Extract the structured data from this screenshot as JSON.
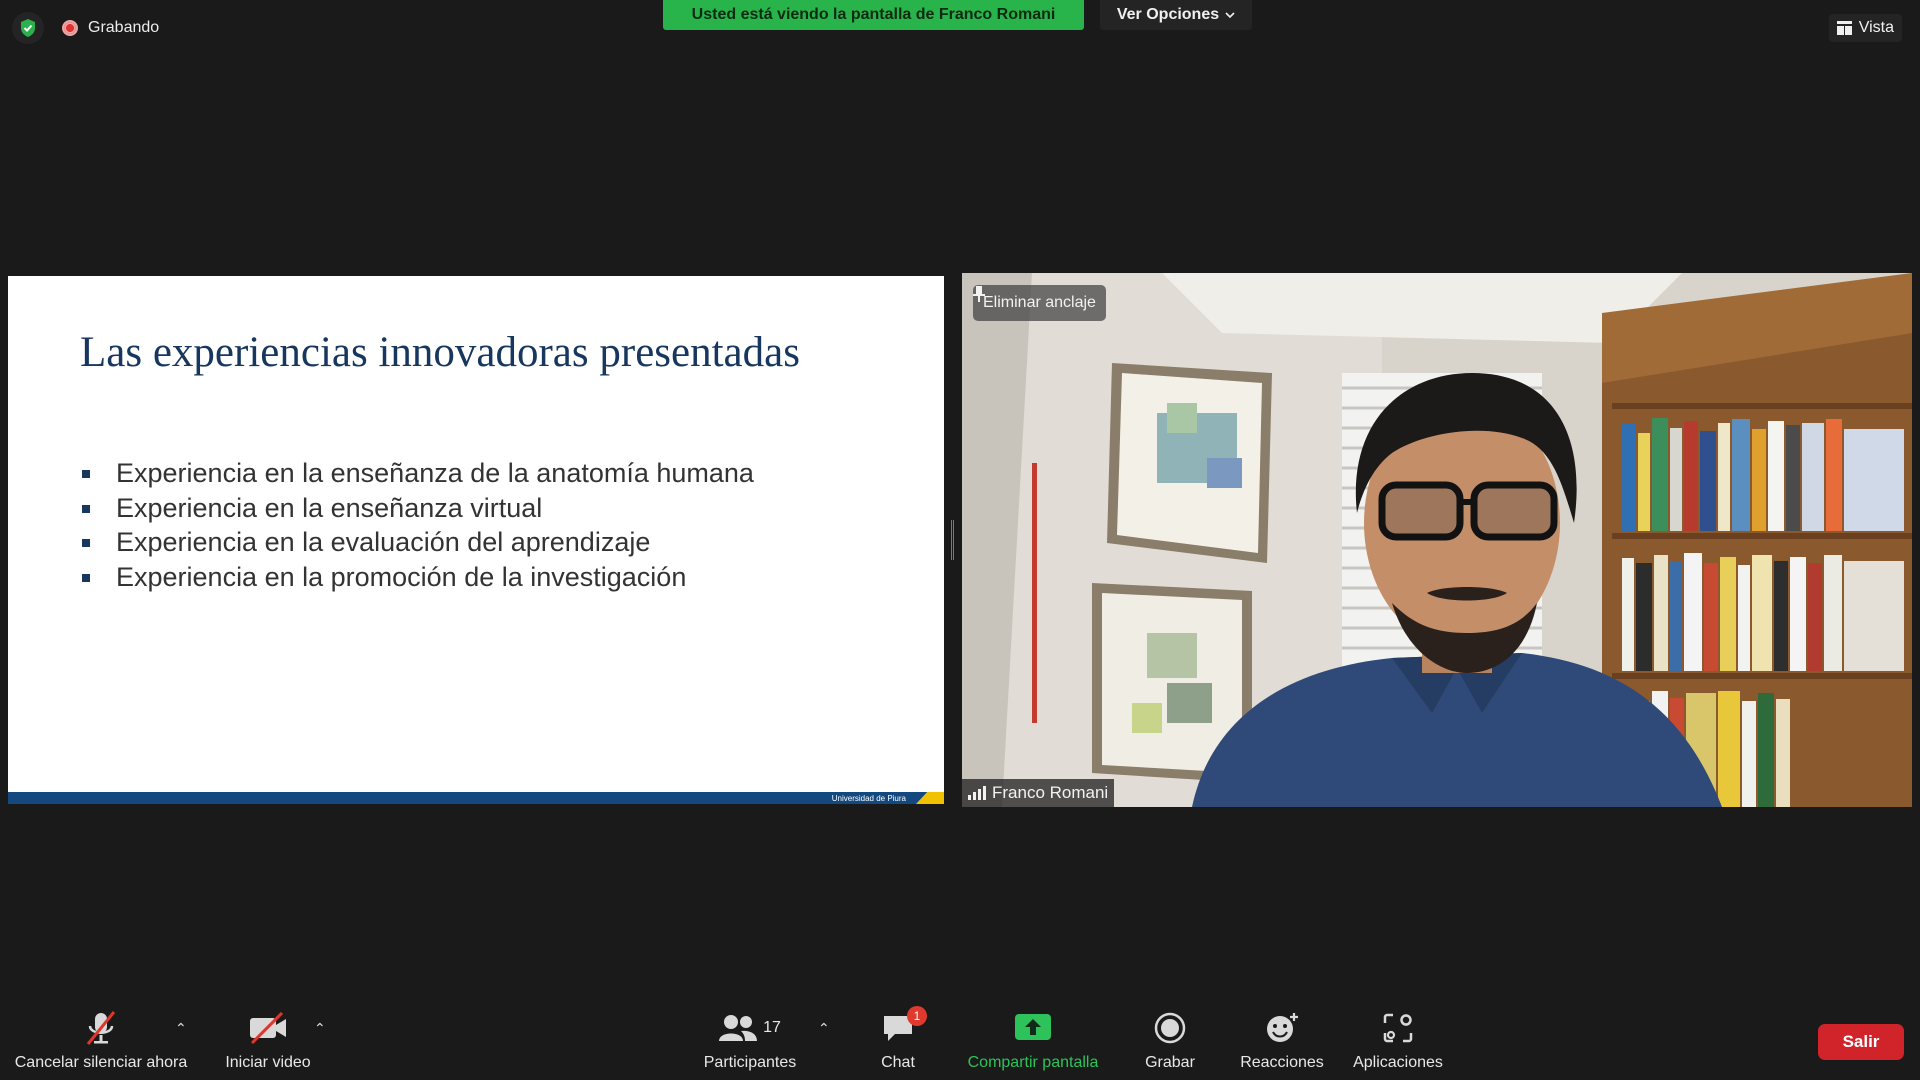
{
  "window": {
    "recording_label": "Grabando",
    "share_banner": "Usted está viendo la pantalla de Franco Romani",
    "view_options": "Ver Opciones",
    "view_button": "Vista"
  },
  "slide": {
    "title": "Las experiencias innovadoras presentadas",
    "bullets": [
      "Experiencia en la enseñanza de la anatomía humana",
      "Experiencia en la enseñanza virtual",
      "Experiencia en la evaluación del aprendizaje",
      "Experiencia en la promoción de la investigación"
    ],
    "footer": "Universidad de Piura"
  },
  "video": {
    "pin_label": "Eliminar anclaje",
    "participant_name": "Franco Romani"
  },
  "toolbar": {
    "unmute": "Cancelar silenciar ahora",
    "start_video": "Iniciar video",
    "participants": "Participantes",
    "participants_count": "17",
    "chat": "Chat",
    "chat_badge": "1",
    "share_screen": "Compartir pantalla",
    "record": "Grabar",
    "reactions": "Reacciones",
    "apps": "Aplicaciones",
    "exit": "Salir"
  },
  "colors": {
    "banner_green": "#29b44b",
    "slide_navy": "#17375e",
    "exit_red": "#d0242a",
    "badge_red": "#e03a2f"
  },
  "icons": [
    "shield-check-icon",
    "record-dot-icon",
    "chevron-down-icon",
    "grid-view-icon",
    "pin-icon",
    "signal-icon",
    "mic-off-icon",
    "video-off-icon",
    "participants-icon",
    "chat-icon",
    "share-screen-icon",
    "record-icon",
    "reactions-icon",
    "apps-icon"
  ]
}
